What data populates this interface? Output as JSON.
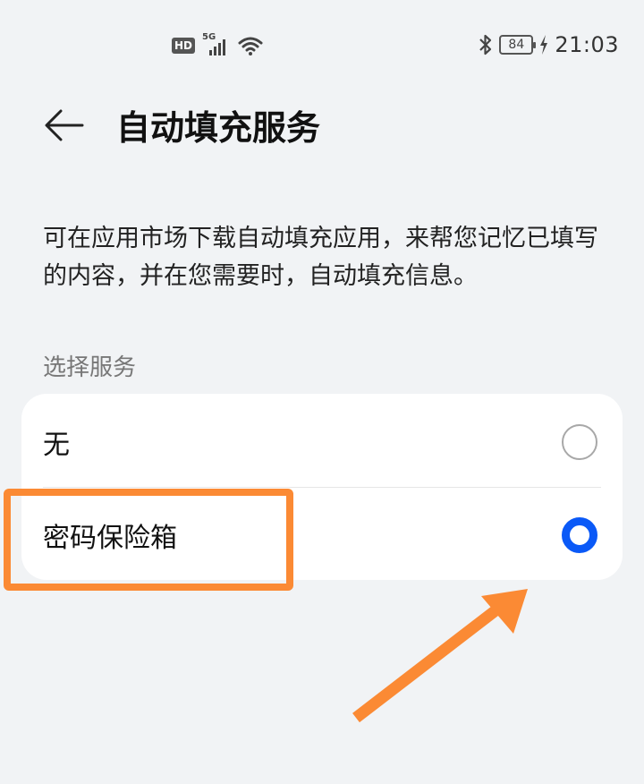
{
  "status_bar": {
    "hd_badge": "HD",
    "network": "5G",
    "battery": "84",
    "time": "21:03"
  },
  "header": {
    "title": "自动填充服务"
  },
  "description": "可在应用市场下载自动填充应用，来帮您记忆已填写的内容，并在您需要时，自动填充信息。",
  "section": {
    "label": "选择服务",
    "options": [
      {
        "label": "无",
        "selected": false
      },
      {
        "label": "密码保险箱",
        "selected": true
      }
    ]
  },
  "colors": {
    "accent": "#0a59f7",
    "annotation": "#fb8a34",
    "background": "#f1f3f5"
  }
}
